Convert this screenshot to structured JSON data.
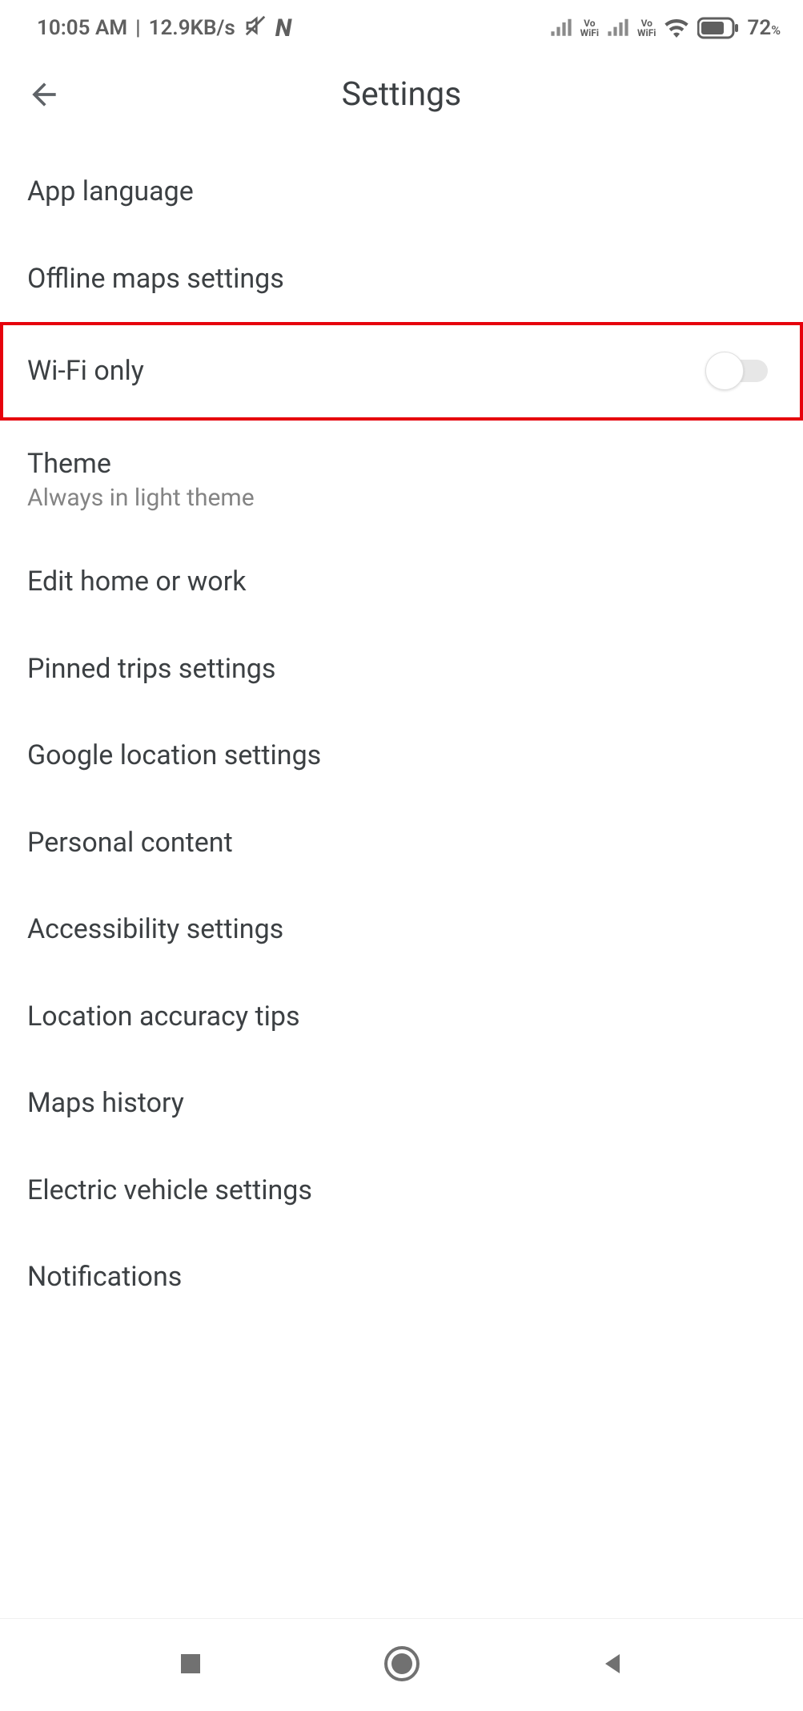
{
  "status": {
    "time": "10:05 AM",
    "net_speed": "12.9KB/s",
    "battery_pct": "72",
    "vowifi_label": "Vo",
    "vowifi_sub": "WiFi"
  },
  "header": {
    "title": "Settings"
  },
  "items": {
    "app_language": "App language",
    "offline_maps": "Offline maps settings",
    "wifi_only": "Wi-Fi only",
    "theme_label": "Theme",
    "theme_value": "Always in light theme",
    "edit_home_work": "Edit home or work",
    "pinned_trips": "Pinned trips settings",
    "google_location": "Google location settings",
    "personal_content": "Personal content",
    "accessibility": "Accessibility settings",
    "location_accuracy": "Location accuracy tips",
    "maps_history": "Maps history",
    "ev_settings": "Electric vehicle settings",
    "notifications": "Notifications"
  },
  "wifi_only_toggle": false
}
